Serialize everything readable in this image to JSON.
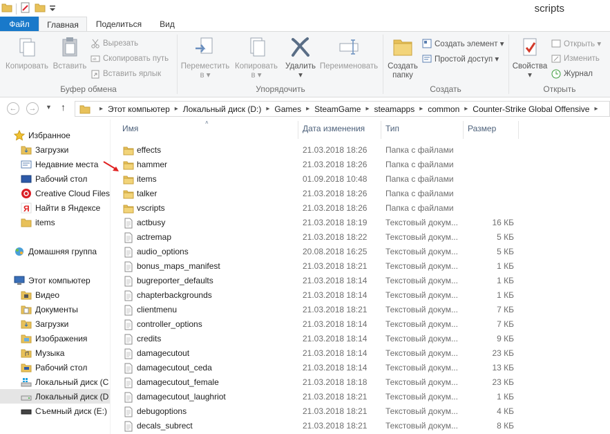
{
  "window": {
    "title": "scripts"
  },
  "tabs": {
    "file": "Файл",
    "home": "Главная",
    "share": "Поделиться",
    "view": "Вид"
  },
  "ribbon": {
    "clipboard": {
      "label": "Буфер обмена",
      "copy": "Копировать",
      "paste": "Вставить",
      "cut": "Вырезать",
      "copy_path": "Скопировать путь",
      "paste_shortcut": "Вставить ярлык"
    },
    "organize": {
      "label": "Упорядочить",
      "move_to": "Переместить",
      "move_to_sub": "в ▾",
      "copy_to": "Копировать",
      "copy_to_sub": "в ▾",
      "delete": "Удалить",
      "delete_sub": "▾",
      "rename": "Переименовать"
    },
    "new": {
      "label": "Создать",
      "new_folder": "Создать",
      "new_folder_sub": "папку",
      "new_item": "Создать элемент ▾",
      "easy_access": "Простой доступ ▾"
    },
    "open": {
      "label": "Открыть",
      "properties": "Свойства",
      "properties_sub": "▾",
      "open": "Открыть ▾",
      "edit": "Изменить",
      "history": "Журнал"
    }
  },
  "address": {
    "crumbs": [
      "Этот компьютер",
      "Локальный диск (D:)",
      "Games",
      "SteamGame",
      "steamapps",
      "common",
      "Counter-Strike Global Offensive"
    ]
  },
  "navpane": {
    "favorites": {
      "header": "Избранное",
      "items": [
        "Загрузки",
        "Недавние места",
        "Рабочий стол",
        "Creative Cloud Files",
        "Найти в Яндексе",
        "items"
      ]
    },
    "homegroup": "Домашняя группа",
    "computer": {
      "header": "Этот компьютер",
      "items": [
        "Видео",
        "Документы",
        "Загрузки",
        "Изображения",
        "Музыка",
        "Рабочий стол",
        "Локальный диск (C",
        "Локальный диск (D",
        "Съемный диск (E:)"
      ]
    }
  },
  "columns": {
    "name": "Имя",
    "date": "Дата изменения",
    "type": "Тип",
    "size": "Размер"
  },
  "files": [
    {
      "name": "effects",
      "date": "21.03.2018 18:26",
      "type": "Папка с файлами",
      "size": "",
      "kind": "folder"
    },
    {
      "name": "hammer",
      "date": "21.03.2018 18:26",
      "type": "Папка с файлами",
      "size": "",
      "kind": "folder"
    },
    {
      "name": "items",
      "date": "01.09.2018 10:48",
      "type": "Папка с файлами",
      "size": "",
      "kind": "folder"
    },
    {
      "name": "talker",
      "date": "21.03.2018 18:26",
      "type": "Папка с файлами",
      "size": "",
      "kind": "folder"
    },
    {
      "name": "vscripts",
      "date": "21.03.2018 18:26",
      "type": "Папка с файлами",
      "size": "",
      "kind": "folder"
    },
    {
      "name": "actbusy",
      "date": "21.03.2018 18:19",
      "type": "Текстовый докум...",
      "size": "16 КБ",
      "kind": "doc"
    },
    {
      "name": "actremap",
      "date": "21.03.2018 18:22",
      "type": "Текстовый докум...",
      "size": "5 КБ",
      "kind": "doc"
    },
    {
      "name": "audio_options",
      "date": "20.08.2018 16:25",
      "type": "Текстовый докум...",
      "size": "5 КБ",
      "kind": "doc"
    },
    {
      "name": "bonus_maps_manifest",
      "date": "21.03.2018 18:21",
      "type": "Текстовый докум...",
      "size": "1 КБ",
      "kind": "doc"
    },
    {
      "name": "bugreporter_defaults",
      "date": "21.03.2018 18:14",
      "type": "Текстовый докум...",
      "size": "1 КБ",
      "kind": "doc"
    },
    {
      "name": "chapterbackgrounds",
      "date": "21.03.2018 18:14",
      "type": "Текстовый докум...",
      "size": "1 КБ",
      "kind": "doc"
    },
    {
      "name": "clientmenu",
      "date": "21.03.2018 18:21",
      "type": "Текстовый докум...",
      "size": "7 КБ",
      "kind": "doc"
    },
    {
      "name": "controller_options",
      "date": "21.03.2018 18:14",
      "type": "Текстовый докум...",
      "size": "7 КБ",
      "kind": "doc"
    },
    {
      "name": "credits",
      "date": "21.03.2018 18:14",
      "type": "Текстовый докум...",
      "size": "9 КБ",
      "kind": "doc"
    },
    {
      "name": "damagecutout",
      "date": "21.03.2018 18:14",
      "type": "Текстовый докум...",
      "size": "23 КБ",
      "kind": "doc"
    },
    {
      "name": "damagecutout_ceda",
      "date": "21.03.2018 18:14",
      "type": "Текстовый докум...",
      "size": "13 КБ",
      "kind": "doc"
    },
    {
      "name": "damagecutout_female",
      "date": "21.03.2018 18:18",
      "type": "Текстовый докум...",
      "size": "23 КБ",
      "kind": "doc"
    },
    {
      "name": "damagecutout_laughriot",
      "date": "21.03.2018 18:21",
      "type": "Текстовый докум...",
      "size": "1 КБ",
      "kind": "doc"
    },
    {
      "name": "debugoptions",
      "date": "21.03.2018 18:21",
      "type": "Текстовый докум...",
      "size": "4 КБ",
      "kind": "doc"
    },
    {
      "name": "decals_subrect",
      "date": "21.03.2018 18:21",
      "type": "Текстовый докум...",
      "size": "8 КБ",
      "kind": "doc"
    }
  ],
  "colors": {
    "accent": "#1979ca",
    "folder": "#e8c15a",
    "arrow": "#e02020"
  }
}
